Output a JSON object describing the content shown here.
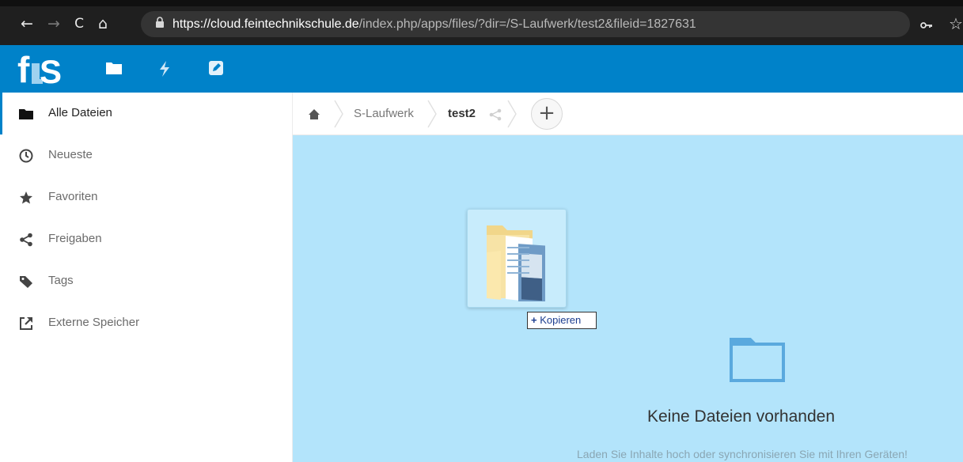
{
  "browser": {
    "back_icon": "←",
    "forward_icon": "→",
    "reload_icon": "C",
    "home_icon": "⌂",
    "url_host": "https://cloud.feintechnikschule.de",
    "url_path": "/index.php/apps/files/?dir=/S-Laufwerk/test2&fileid=1827631",
    "key_icon": "o-",
    "star_icon": "☆"
  },
  "header": {
    "logo_text": "fls",
    "apps": [
      "files-icon",
      "activity-icon",
      "notes-icon"
    ]
  },
  "sidebar": {
    "items": [
      {
        "label": "Alle Dateien",
        "icon": "folder-icon",
        "active": true
      },
      {
        "label": "Neueste",
        "icon": "clock-icon"
      },
      {
        "label": "Favoriten",
        "icon": "star-icon"
      },
      {
        "label": "Freigaben",
        "icon": "share-icon"
      },
      {
        "label": "Tags",
        "icon": "tag-icon"
      },
      {
        "label": "Externe Speicher",
        "icon": "external-icon"
      }
    ]
  },
  "breadcrumb": {
    "home_icon": "home-icon",
    "items": [
      "S-Laufwerk",
      "test2"
    ],
    "add_label": "+"
  },
  "drag": {
    "tooltip_plus": "+",
    "tooltip_label": "Kopieren"
  },
  "empty": {
    "title": "Keine Dateien vorhanden",
    "subtitle": "Laden Sie Inhalte hoch oder synchronisieren Sie mit Ihren Geräten!"
  },
  "colors": {
    "brand": "#0082c9",
    "drop_area": "#b3e4fb"
  }
}
